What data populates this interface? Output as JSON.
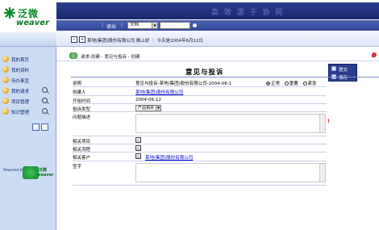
{
  "header": {
    "logo_cn": "泛微",
    "logo_en": "weaver",
    "banner_title": "高 效 源 于 协 同",
    "nav_link": "退出",
    "doc_select": "文档"
  },
  "sidebar": {
    "items": [
      {
        "label": "我的首页",
        "has_search": false
      },
      {
        "label": "我的资料",
        "has_search": false
      },
      {
        "label": "待办事宜",
        "has_search": false
      },
      {
        "label": "我的请求",
        "has_search": true
      },
      {
        "label": "项目管理",
        "has_search": true
      },
      {
        "label": "知识管理",
        "has_search": true
      }
    ],
    "powered_by": "Powered by",
    "mini_logo_cn": "泛微",
    "mini_logo_en": "weaver"
  },
  "infobar": {
    "text": "某地(集团)股份有限公司  晚上好 ｜ 今天是2004年6月12日"
  },
  "breadcrumb": {
    "text": "请求:创建 - 意见与投诉 - 创建"
  },
  "form": {
    "title": "意见与投诉",
    "side_menu": [
      "提交",
      "保存"
    ],
    "fields": {
      "description": {
        "label": "说明",
        "value": "意见与投诉-某地(集团)股份有限公司-2004-06-1"
      },
      "urgency_options": [
        {
          "label": "正常",
          "selected": true
        },
        {
          "label": "重要",
          "selected": false
        },
        {
          "label": "紧急",
          "selected": false
        }
      ],
      "creator": {
        "label": "创建人",
        "value": "某地(集团)股份有限公司"
      },
      "start_date": {
        "label": "开始时间",
        "value": "2004-06-12"
      },
      "complaint_type": {
        "label": "投诉类型",
        "value": "产品相关"
      },
      "issue_desc": {
        "label": "问题描述",
        "value": "",
        "required_mark": "!"
      },
      "related_project": {
        "label": "相关项目",
        "value": ""
      },
      "related_flow": {
        "label": "相关流程",
        "value": ""
      },
      "related_customer": {
        "label": "相关客户",
        "value": "某地(集团)股份有限公司"
      },
      "signature": {
        "label": "签字",
        "value": ""
      }
    }
  },
  "colors": {
    "banner": "#1a2a6c",
    "sidebar": "#ccdcf4",
    "link": "#0000cc",
    "side_menu": "#2a3f8c"
  }
}
